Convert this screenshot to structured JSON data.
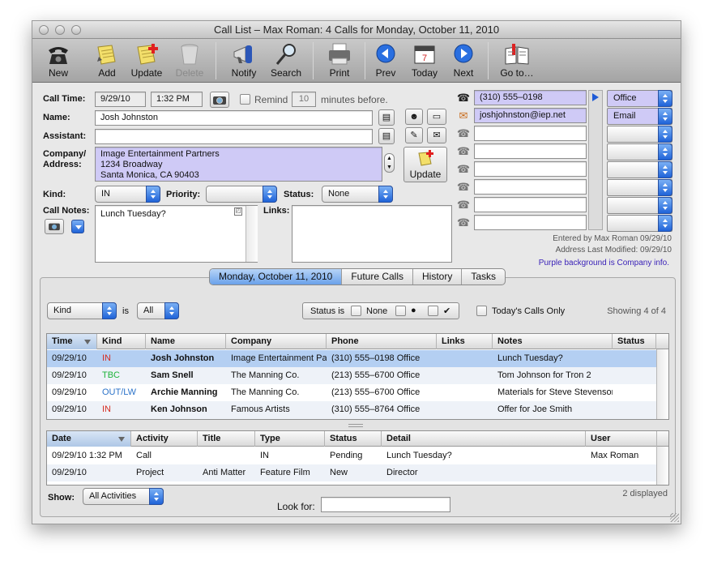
{
  "window": {
    "title": "Call List – Max Roman:   4 Calls for Monday, October 11, 2010"
  },
  "toolbar": [
    {
      "label": "New",
      "icon": "telephone-icon",
      "enabled": true
    },
    {
      "label": "Add",
      "icon": "notepad-add-icon",
      "enabled": true
    },
    {
      "label": "Update",
      "icon": "notepad-update-icon",
      "enabled": true
    },
    {
      "label": "Delete",
      "icon": "trash-icon",
      "enabled": false
    },
    {
      "label": "Notify",
      "icon": "megaphone-icon",
      "enabled": true
    },
    {
      "label": "Search",
      "icon": "magnifier-icon",
      "enabled": true
    },
    {
      "label": "Print",
      "icon": "printer-icon",
      "enabled": true
    },
    {
      "label": "Prev",
      "icon": "left-arrow-icon",
      "enabled": true
    },
    {
      "label": "Today",
      "icon": "calendar-icon",
      "enabled": true
    },
    {
      "label": "Next",
      "icon": "right-arrow-icon",
      "enabled": true
    },
    {
      "label": "Go to…",
      "icon": "book-icon",
      "enabled": true
    }
  ],
  "form": {
    "call_time_label": "Call Time:",
    "call_date": "9/29/10",
    "call_clock": "1:32 PM",
    "remind_label": "Remind",
    "remind_minutes": "10",
    "remind_suffix": "minutes before.",
    "name_label": "Name:",
    "name_value": "Josh Johnston",
    "assistant_label": "Assistant:",
    "assistant_value": "",
    "company_label_1": "Company/",
    "company_label_2": "Address:",
    "address_lines": [
      "Image Entertainment Partners",
      "1234 Broadway",
      "Santa Monica, CA  90403"
    ],
    "address_update_label": "Update",
    "kind_label": "Kind:",
    "kind_value": "IN",
    "priority_label": "Priority:",
    "priority_value": "",
    "status_label": "Status:",
    "status_value": "None",
    "notes_label": "Call Notes:",
    "notes_value": "Lunch Tuesday?",
    "links_label": "Links:",
    "links_value": ""
  },
  "contacts": [
    {
      "value": "(310) 555–0198",
      "type": "Office",
      "purple": true
    },
    {
      "value": "joshjohnston@iep.net",
      "type": "Email",
      "purple": true
    },
    {
      "value": "",
      "type": "",
      "purple": false
    },
    {
      "value": "",
      "type": "",
      "purple": false
    },
    {
      "value": "",
      "type": "",
      "purple": false
    },
    {
      "value": "",
      "type": "",
      "purple": false
    },
    {
      "value": "",
      "type": "",
      "purple": false
    },
    {
      "value": "",
      "type": "",
      "purple": false
    }
  ],
  "info": {
    "entered_by": "Entered by  Max Roman 09/29/10",
    "address_modified": "Address Last Modified: 09/29/10",
    "purple_note": "Purple background is Company info.",
    "purple_note_color": "#3a22b8"
  },
  "tabs": [
    {
      "label": "Monday, October 11, 2010",
      "active": true
    },
    {
      "label": "Future Calls",
      "active": false
    },
    {
      "label": "History",
      "active": false
    },
    {
      "label": "Tasks",
      "active": false
    }
  ],
  "filter": {
    "field": "Kind",
    "is_label": "is",
    "value": "All",
    "status_is_label": "Status is",
    "status_none_label": "None",
    "status_dot_label": "●",
    "status_check_label": "✔",
    "today_only_label": "Today's Calls Only",
    "showing": "Showing 4 of 4"
  },
  "calls_table": {
    "columns": [
      "Time",
      "Kind",
      "Name",
      "Company",
      "Phone",
      "Links",
      "Notes",
      "Status"
    ],
    "rows": [
      {
        "time": "09/29/10",
        "kind": "IN",
        "kind_class": "c-in",
        "name": "Josh Johnston",
        "company": "Image Entertainment Partners",
        "phone": "(310) 555–0198 Office",
        "links": "",
        "notes": "Lunch Tuesday?",
        "status": "",
        "selected": true
      },
      {
        "time": "09/29/10",
        "kind": "TBC",
        "kind_class": "c-tbc",
        "name": "Sam Snell",
        "company": "The Manning Co.",
        "phone": "(213) 555–6700 Office",
        "links": "",
        "notes": "Tom Johnson for Tron 2",
        "status": "",
        "selected": false
      },
      {
        "time": "09/29/10",
        "kind": "OUT/LW",
        "kind_class": "c-out",
        "name": "Archie Manning",
        "company": "The Manning Co.",
        "phone": "(213) 555–6700 Office",
        "links": "",
        "notes": "Materials for Steve Stevenson",
        "status": "",
        "selected": false
      },
      {
        "time": "09/29/10",
        "kind": "IN",
        "kind_class": "c-in",
        "name": "Ken Johnson",
        "company": "Famous Artists",
        "phone": "(310) 555–8764 Office",
        "links": "",
        "notes": "Offer for Joe Smith",
        "status": "",
        "selected": false
      }
    ]
  },
  "activity_table": {
    "columns": [
      "Date",
      "Activity",
      "Title",
      "Type",
      "Status",
      "Detail",
      "User"
    ],
    "rows": [
      {
        "date": "09/29/10 1:32 PM",
        "activity": "Call",
        "title": "",
        "type": "IN",
        "status": "Pending",
        "detail": "Lunch Tuesday?",
        "user": "Max Roman"
      },
      {
        "date": "09/29/10",
        "activity": "Project",
        "title": "Anti Matter",
        "type": "Feature Film",
        "status": "New",
        "detail": "Director",
        "user": ""
      }
    ]
  },
  "bottom": {
    "show_label": "Show:",
    "show_value": "All Activities",
    "look_for_label": "Look for:",
    "look_for_value": "",
    "displayed": "2 displayed"
  }
}
